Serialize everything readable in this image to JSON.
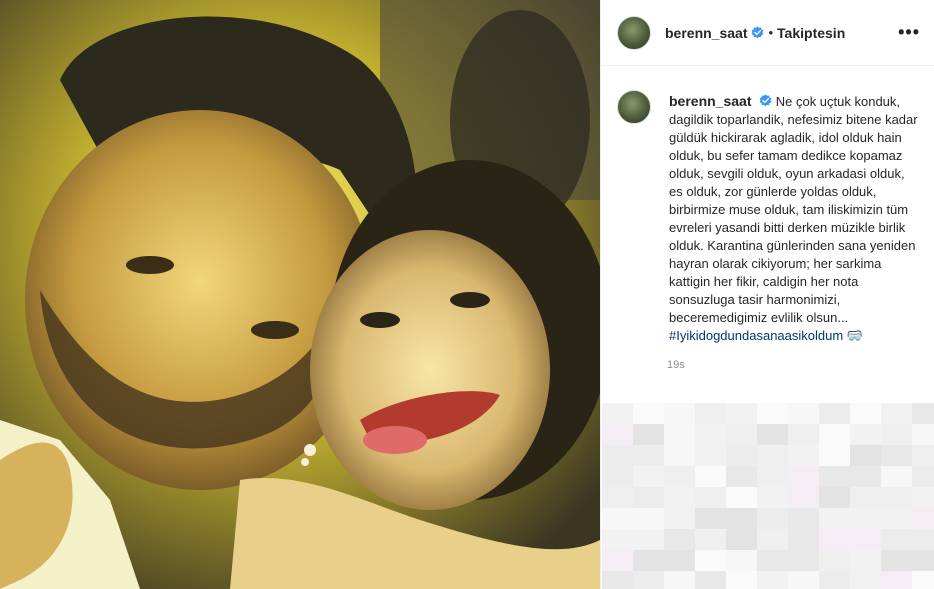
{
  "post": {
    "username": "berenn_saat",
    "separator": "•",
    "follow_label": "Takiptesin",
    "more_label": "•••",
    "caption": "Ne çok uçtuk konduk, dagildik toparlandik, nefesimiz bitene kadar güldük hickirarak agladik, idol olduk hain olduk, bu sefer tamam dedikce kopamaz olduk, sevgili olduk, oyun arkadasi olduk, es olduk, zor günlerde yoldas olduk, birbirmize muse olduk, tam iliskimizin tüm evreleri yasandi bitti derken müzikle birlik olduk. Karantina günlerinden sana yeniden hayran olarak cikiyorum; her sarkima kattigin her fikir, caldigin her nota sonsuzluga tasir harmonimizi, beceremedigimiz evlilik olsun...",
    "hashtag": "#Iyikidogdundasanaasikoldum",
    "emoji": "🥽",
    "time": "19s"
  },
  "icons": {
    "verified": "verified-badge-icon",
    "more": "more-options-icon"
  },
  "colors": {
    "verified": "#3897f0",
    "hashtag": "#00376b",
    "muted": "#8e8e8e"
  }
}
